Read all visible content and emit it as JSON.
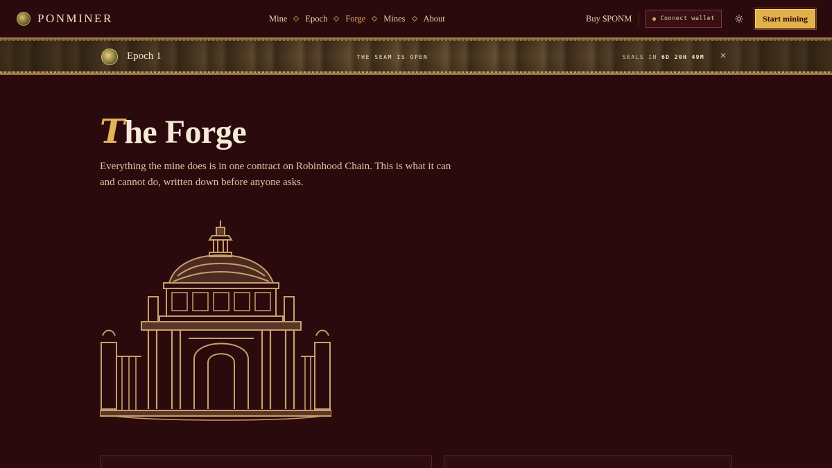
{
  "nav": {
    "brand": "PONMINER",
    "links": [
      {
        "label": "Mine",
        "active": false
      },
      {
        "label": "Epoch",
        "active": false
      },
      {
        "label": "Forge",
        "active": true
      },
      {
        "label": "Mines",
        "active": false
      },
      {
        "label": "About",
        "active": false
      }
    ],
    "buy_label": "Buy $PONM",
    "wallet_label": "Connect wallet",
    "start_label": "Start mining"
  },
  "banner": {
    "epoch_title": "Epoch 1",
    "status": "THE SEAM IS OPEN",
    "seals_prefix": "SEALS IN",
    "seals_countdown": "6D 20H 49M"
  },
  "page": {
    "title_initial": "T",
    "title_rest": "he Forge",
    "lede": "Everything the mine does is in one contract on Robinhood Chain. This is what it can and cannot do, written down before anyone asks."
  },
  "colors": {
    "background": "#2b0a0e",
    "accent": "#e2b35a",
    "illustration": "#c8a06a"
  },
  "icons": {
    "brand": "gem-orb-icon",
    "theme": "sun-icon",
    "close": "close-icon",
    "separator": "diamond-icon"
  }
}
